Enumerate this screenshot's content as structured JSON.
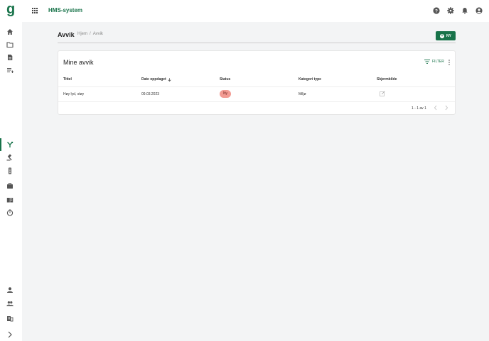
{
  "app": {
    "title": "HMS-system",
    "logo_letter": "g"
  },
  "header_icons": [
    "help-icon",
    "settings-icon",
    "notifications-icon",
    "account-icon"
  ],
  "sidebar": {
    "items": [
      {
        "name": "home-icon"
      },
      {
        "name": "folder-icon"
      },
      {
        "name": "document-icon"
      },
      {
        "name": "checklist-icon"
      },
      {
        "name": "deviation-icon",
        "active": true
      },
      {
        "name": "gavel-icon"
      },
      {
        "name": "traffic-light-icon"
      },
      {
        "name": "briefcase-icon"
      },
      {
        "name": "book-icon"
      },
      {
        "name": "timer-icon"
      },
      {
        "name": "person-icon"
      },
      {
        "name": "people-icon"
      },
      {
        "name": "building-icon"
      },
      {
        "name": "chevron-right-icon"
      }
    ]
  },
  "page": {
    "title": "Avvik",
    "breadcrumb": {
      "home": "Hjem",
      "separator": "/",
      "current": "Avvik"
    },
    "new_button": "NY"
  },
  "card": {
    "title": "Mine avvik",
    "filter_label": "FILTER",
    "columns": [
      "Tittel",
      "Date oppdaget",
      "Status",
      "Kategori type",
      "Skjermbilde"
    ],
    "rows": [
      {
        "title": "Høy lyd, støy",
        "date": "09.03.2023",
        "status": "Ny",
        "category": "Miljø"
      }
    ],
    "pagination": "1 - 1 av 1"
  },
  "colors": {
    "brand": "#18734a",
    "status_new": "#f29b93",
    "background": "#f3f4f5"
  }
}
